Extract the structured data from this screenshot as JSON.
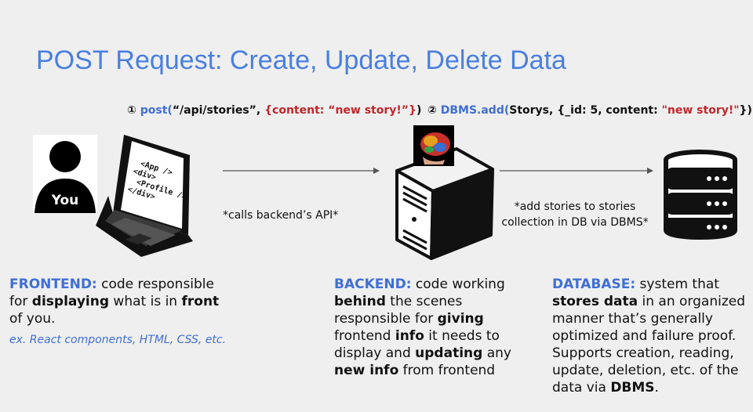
{
  "title": "POST Request: Create, Update, Delete Data",
  "step1": {
    "num": "①",
    "fn": "post(",
    "arg1": "“/api/stories”, ",
    "arg2": "{content: “new story!”}",
    "close": ")"
  },
  "step2": {
    "num": "②",
    "fn": "DBMS.add(",
    "args": "Storys, {_id:  5, content:  ",
    "val": "\"new story!\"",
    "close": "})"
  },
  "user_label": "You",
  "code": [
    "<App />",
    "<div>",
    "<Profile />",
    "</div>"
  ],
  "arrow1_note": "*calls backend’s API*",
  "arrow2_note": [
    "*add stories to stories",
    "collection in DB via DBMS*"
  ],
  "frontend": {
    "heading": "FRONTEND:",
    "t1": " code responsible for ",
    "b1": "displaying",
    "t2": " what is in ",
    "b2": "front",
    "t3": " of you.",
    "example": "ex. React components, HTML, CSS, etc."
  },
  "backend": {
    "heading": "BACKEND:",
    "t1": " code working ",
    "b1": "behind",
    "t2": " the scenes responsible for ",
    "b2": "giving",
    "t3": " frontend ",
    "b3": "info",
    "t4": " it needs to display and ",
    "b4": "updating",
    "t5": " any ",
    "b5": "new info",
    "t6": " from frontend"
  },
  "database": {
    "heading": "DATABASE:",
    "t1": " system that ",
    "b1": "stores data",
    "t2": " in an organized manner that’s generally optimized and failure proof. Supports creation, reading, update, deletion, etc. of the data via ",
    "b2": "DBMS",
    "t3": "."
  }
}
